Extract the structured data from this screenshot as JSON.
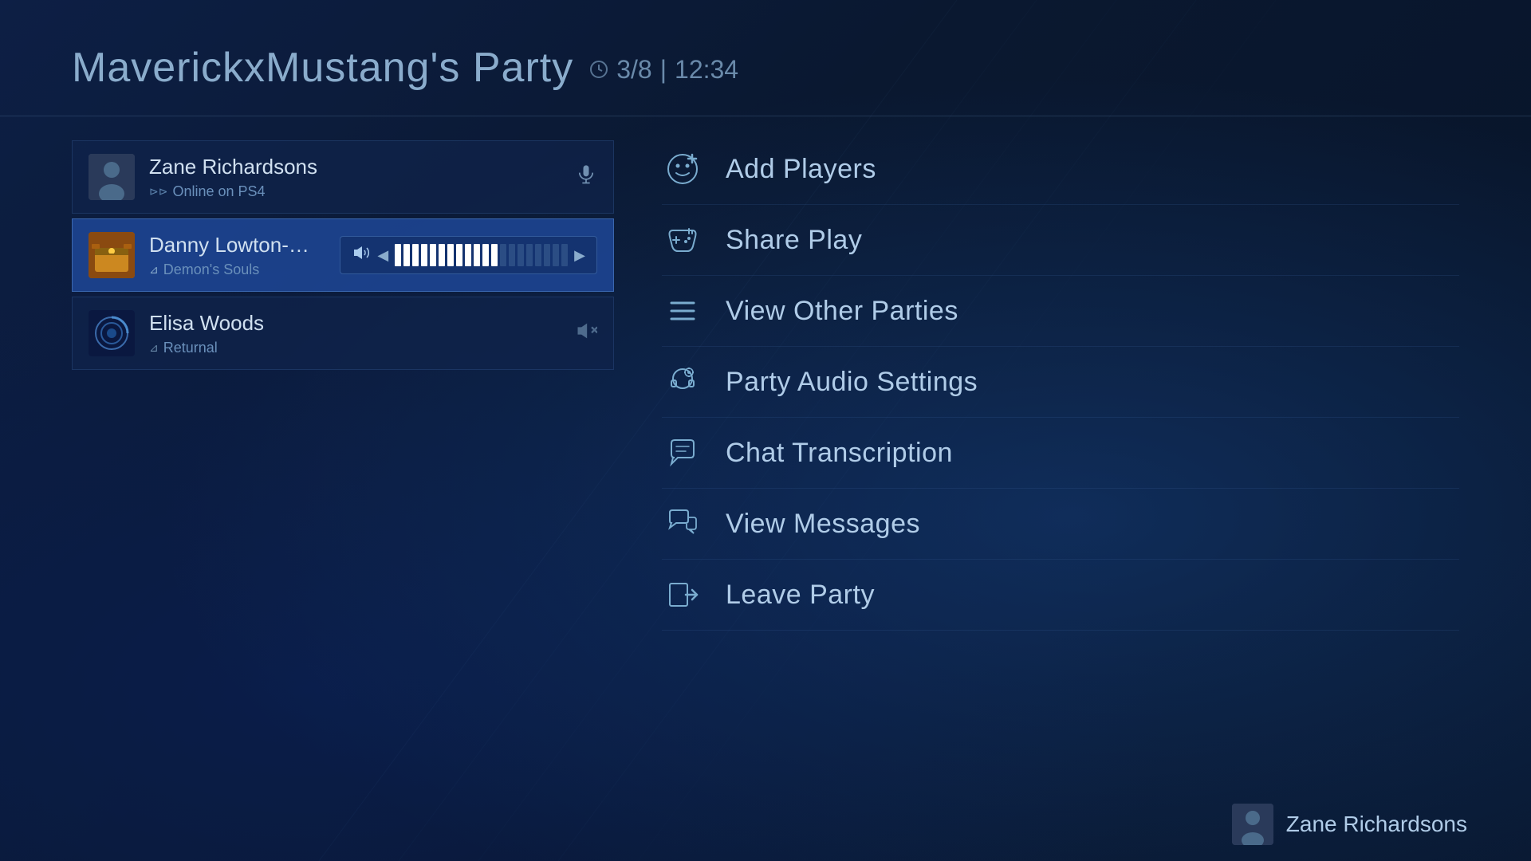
{
  "header": {
    "party_name": "MaverickxMustang's Party",
    "member_count": "3/8",
    "time": "12:34"
  },
  "members": [
    {
      "id": "zane",
      "name": "Zane Richardsons",
      "status": "Online on PS4",
      "status_icon": "ps4",
      "mic": "active",
      "active": false
    },
    {
      "id": "danny",
      "name": "Danny Lowton-Micha...",
      "status": "Demon's Souls",
      "status_icon": "game",
      "mic": "volume",
      "active": true
    },
    {
      "id": "elisa",
      "name": "Elisa Woods",
      "status": "Returnal",
      "status_icon": "game",
      "mic": "muted",
      "active": false
    }
  ],
  "menu": {
    "items": [
      {
        "id": "add-players",
        "label": "Add Players",
        "icon": "add-players"
      },
      {
        "id": "share-play",
        "label": "Share Play",
        "icon": "share-play"
      },
      {
        "id": "view-other-parties",
        "label": "View Other Parties",
        "icon": "view-parties"
      },
      {
        "id": "party-audio-settings",
        "label": "Party Audio Settings",
        "icon": "audio-settings"
      },
      {
        "id": "chat-transcription",
        "label": "Chat Transcription",
        "icon": "chat-transcript"
      },
      {
        "id": "view-messages",
        "label": "View Messages",
        "icon": "view-messages"
      },
      {
        "id": "leave-party",
        "label": "Leave Party",
        "icon": "leave-party"
      }
    ]
  },
  "bottom_bar": {
    "username": "Zane Richardsons"
  }
}
